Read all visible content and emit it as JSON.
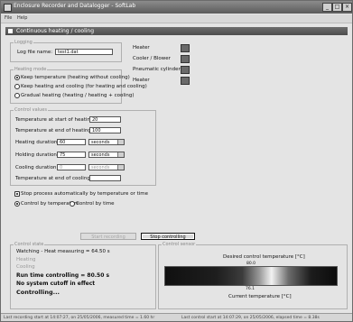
{
  "window": {
    "title": "Enclosure Recorder and Datalogger - SoftLab"
  },
  "menu": [
    "File",
    "Help"
  ],
  "panel": {
    "title": "Continuous heating / cooling"
  },
  "logfile": {
    "group": "Logging",
    "label": "Log file name:",
    "value": "test1.dat"
  },
  "mode": {
    "group": "Heating mode",
    "options": [
      "Keep temperature (heating without cooling)",
      "Keep heating and cooling (for heating and cooling)",
      "Gradual heating (heating / heating + cooling)"
    ],
    "selected": 0
  },
  "status_leds": [
    {
      "label": "Heater"
    },
    {
      "label": "Cooler / Blower"
    },
    {
      "label": "Pneumatic cylinder"
    },
    {
      "label": "Heater"
    }
  ],
  "control": {
    "group": "Control values",
    "fields": [
      {
        "label": "Temperature at start of heating [°C]:",
        "value": "20"
      },
      {
        "label": "Temperature at end of heating [°C]:",
        "value": "100"
      },
      {
        "label": "Heating duration:",
        "value": "60",
        "unit": "seconds"
      },
      {
        "label": "Holding duration:",
        "value": "75",
        "unit": "seconds"
      },
      {
        "label": "Cooling duration:",
        "value": "0",
        "unit": "seconds"
      },
      {
        "label": "Temperature at end of cooling [°C]:",
        "value": ""
      }
    ]
  },
  "stop": {
    "label": "Stop process automatically by temperature or time",
    "options": [
      "Control by temperature",
      "Control by time"
    ],
    "selected": 0
  },
  "buttons": {
    "start": "Start recording",
    "stop": "Stop controlling"
  },
  "log": {
    "group": "Control state",
    "lines": [
      {
        "text": "Watching - Heat measuring = 64.50 s",
        "style": "normal"
      },
      {
        "text": "Heating",
        "style": "gray"
      },
      {
        "text": "Cooling",
        "style": "gray"
      },
      {
        "text": "Run time controlling = 80.50 s",
        "style": "bold"
      },
      {
        "text": "No system cutoff in effect",
        "style": "bold"
      },
      {
        "text": "Controlling...",
        "style": "bold"
      }
    ]
  },
  "display": {
    "group": "Control sensor",
    "label_top": "Desired control temperature [°C]",
    "value_top": "80.0",
    "value_bottom": "76.1",
    "label_bottom": "Current temperature [°C]"
  },
  "status": {
    "left": "Last recording start at 14:07:27, on 25/05/2006, measured time = 1.60 hr",
    "right": "Last control start at 14:07:29, on 25/05/2006, elapsed time = 8.38s"
  }
}
